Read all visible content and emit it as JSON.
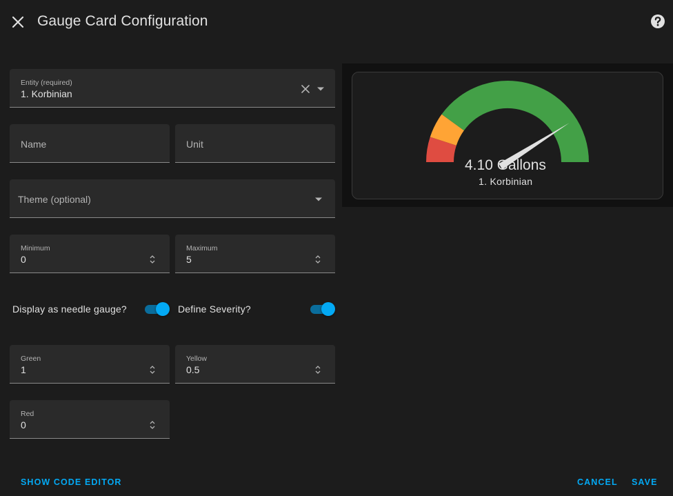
{
  "dialog": {
    "title": "Gauge Card Configuration"
  },
  "form": {
    "entity": {
      "label": "Entity (required)",
      "value": "1. Korbinian"
    },
    "name": {
      "placeholder": "Name"
    },
    "unit": {
      "placeholder": "Unit"
    },
    "theme": {
      "placeholder": "Theme (optional)"
    },
    "minimum": {
      "label": "Minimum",
      "value": "0"
    },
    "maximum": {
      "label": "Maximum",
      "value": "5"
    },
    "needle_toggle": {
      "label": "Display as needle gauge?",
      "checked": true
    },
    "severity_toggle": {
      "label": "Define Severity?",
      "checked": true
    },
    "green": {
      "label": "Green",
      "value": "1"
    },
    "yellow": {
      "label": "Yellow",
      "value": "0.5"
    },
    "red": {
      "label": "Red",
      "value": "0"
    }
  },
  "preview": {
    "value_text": "4.10 Gallons",
    "entity_name": "1. Korbinian",
    "min": 0,
    "max": 5,
    "value": 4.1,
    "severity": {
      "red": 0,
      "yellow": 0.5,
      "green": 1
    },
    "colors": {
      "red": "#df4c41",
      "yellow": "#ffa435",
      "green": "#43a047",
      "needle": "#e1e1e1"
    }
  },
  "footer": {
    "code_editor_label": "SHOW CODE EDITOR",
    "cancel_label": "CANCEL",
    "save_label": "SAVE"
  },
  "theme_colors": {
    "accent": "#03a9f4",
    "background": "#1c1c1c",
    "field_background": "#2a2a2a"
  }
}
